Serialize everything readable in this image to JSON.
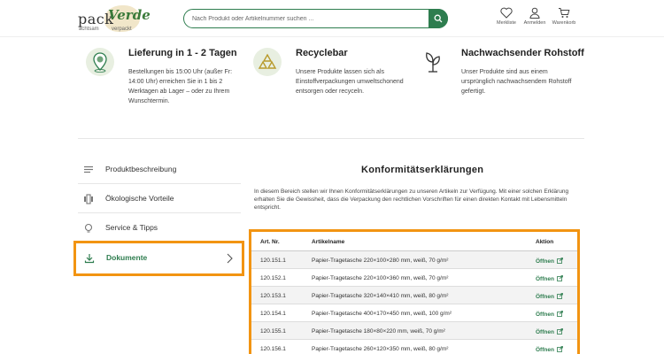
{
  "header": {
    "logo": {
      "pack": "pack",
      "verde": "Verde",
      "sub1": "achtsam",
      "sub2": "verpackt"
    },
    "search": {
      "placeholder": "Nach Produkt oder Artikelnummer suchen ..."
    },
    "icons": [
      {
        "label": "Merkliste",
        "icon": "heart-icon"
      },
      {
        "label": "Anmelden",
        "icon": "user-icon"
      },
      {
        "label": "Warenkorb",
        "icon": "cart-icon"
      }
    ]
  },
  "features": [
    {
      "title": "Lieferung in 1 - 2 Tagen",
      "text": "Bestellungen bis 15:00 Uhr (außer Fr: 14:00 Uhr) erreichen Sie in 1 bis 2 Werktagen ab Lager – oder zu Ihrem Wunschtermin.",
      "icon": "location-pin-icon"
    },
    {
      "title": "Recyclebar",
      "text": "Unsere Produkte lassen sich als Einstoffverpackungen umweltschonend entsorgen oder recyceln.",
      "icon": "recycle-icon"
    },
    {
      "title": "Nachwachsender Rohstoff",
      "text": "Unser Produkte sind aus einem ursprünglich nachwachsendem Rohstoff gefertigt.",
      "icon": "sprout-icon"
    }
  ],
  "sidebar": {
    "items": [
      {
        "label": "Produktbeschreibung",
        "icon": "text-lines-icon"
      },
      {
        "label": "Ökologische Vorteile",
        "icon": "leaf-icon"
      },
      {
        "label": "Service & Tipps",
        "icon": "lightbulb-icon"
      },
      {
        "label": "Dokumente",
        "icon": "download-icon"
      }
    ]
  },
  "content": {
    "title": "Konformitätserklärungen",
    "description": "In diesem Bereich stellen wir Ihnen Konformitätserklärungen zu unseren Artikeln zur Verfügung. Mit einer solchen Erklärung erhalten Sie die Gewissheit, dass die Verpackung den rechtlichen Vorschriften für einen direkten Kontakt mit Lebensmitteln entspricht.",
    "table": {
      "headers": [
        "Art. Nr.",
        "Artikelname",
        "Aktion"
      ],
      "rows": [
        {
          "nr": "120.151.1",
          "name": "Papier-Tragetasche 220×100×280 mm, weiß, 70 g/m²",
          "action": "Öffnen"
        },
        {
          "nr": "120.152.1",
          "name": "Papier-Tragetasche 220×100×360 mm, weiß, 70 g/m²",
          "action": "Öffnen"
        },
        {
          "nr": "120.153.1",
          "name": "Papier-Tragetasche 320×140×410 mm, weiß, 80 g/m²",
          "action": "Öffnen"
        },
        {
          "nr": "120.154.1",
          "name": "Papier-Tragetasche 400×170×450 mm, weiß, 100 g/m²",
          "action": "Öffnen"
        },
        {
          "nr": "120.155.1",
          "name": "Papier-Tragetasche 180×80×220 mm, weiß, 70 g/m²",
          "action": "Öffnen"
        },
        {
          "nr": "120.156.1",
          "name": "Papier-Tragetasche 260×120×350 mm, weiß, 80 g/m²",
          "action": "Öffnen"
        }
      ]
    }
  },
  "colors": {
    "brand_green": "#2e7d4f",
    "highlight_orange": "#f29412",
    "feature_circle": "#e8efe1"
  }
}
